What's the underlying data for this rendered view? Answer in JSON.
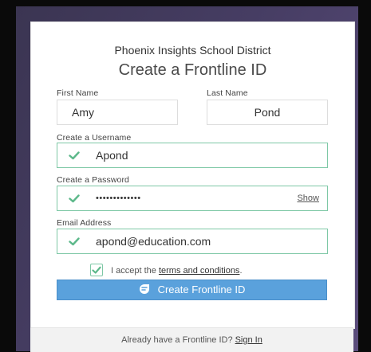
{
  "header": {
    "district": "Phoenix Insights School District",
    "title": "Create a Frontline ID"
  },
  "form": {
    "first_name": {
      "label": "First Name",
      "value": "Amy"
    },
    "last_name": {
      "label": "Last Name",
      "value": "Pond"
    },
    "username": {
      "label": "Create a Username",
      "value": "Apond"
    },
    "password": {
      "label": "Create a Password",
      "value": "•••••••••••••",
      "show_label": "Show"
    },
    "email": {
      "label": "Email Address",
      "value": "apond@education.com"
    },
    "terms": {
      "prefix": "I accept the ",
      "link": "terms and conditions",
      "suffix": "."
    },
    "submit_label": "Create Frontline ID"
  },
  "footer": {
    "prompt": "Already have a Frontline ID?",
    "sign_in": "Sign In"
  },
  "colors": {
    "valid": "#7ec8a6",
    "check": "#5cb88a",
    "primary": "#5aa1dc"
  }
}
